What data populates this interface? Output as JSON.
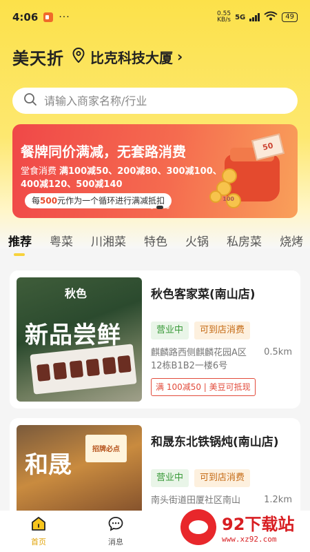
{
  "status_bar": {
    "time": "4:06",
    "dots": "···",
    "speed_value": "0.55",
    "speed_unit": "KB/s",
    "network": "5G",
    "battery": "49"
  },
  "header": {
    "app_title": "美天折",
    "location": "比克科技大厦"
  },
  "search": {
    "placeholder": "请输入商家名称/行业"
  },
  "banner": {
    "title": "餐牌同价满减，无套路消费",
    "line1_label": "堂食消费",
    "line1": "满100减50、200减80、300减100、",
    "line2": "400减120、500减140",
    "pill_pre": "每",
    "pill_num": "500",
    "pill_post": "元作为一个循环进行满减抵扣",
    "bill_value": "50",
    "coin_value": "100"
  },
  "tabs": [
    "推荐",
    "粤菜",
    "川湘菜",
    "特色",
    "火锅",
    "私房菜",
    "烧烤"
  ],
  "shops": [
    {
      "name": "秋色客家菜(南山店)",
      "thumb_brand": "秋色",
      "thumb_headline": "新品尝鲜",
      "status": "营业中",
      "dine": "可到店消费",
      "address": "麒麟路西侧麒麟花园A区12栋B1B2一楼6号",
      "distance": "0.5km",
      "promo": "满 100减50 | 美豆可抵现"
    },
    {
      "name": "和晟东北铁锅炖(南山店)",
      "thumb_sign": "招牌必点",
      "thumb_calligraphy": "和晟",
      "status": "营业中",
      "dine": "可到店消费",
      "address": "南头街道田厦社区南山",
      "distance": "1.2km"
    }
  ],
  "bottom_nav": [
    {
      "label": "首页",
      "icon": "home-icon"
    },
    {
      "label": "消息",
      "icon": "message-icon"
    }
  ],
  "watermark": {
    "title": "92下载站",
    "url": "www.xz92.com"
  },
  "colors": {
    "accent": "#fce14a",
    "banner_red": "#f04848",
    "open_green": "#3a9a3a",
    "promo_red": "#e24a3a"
  }
}
